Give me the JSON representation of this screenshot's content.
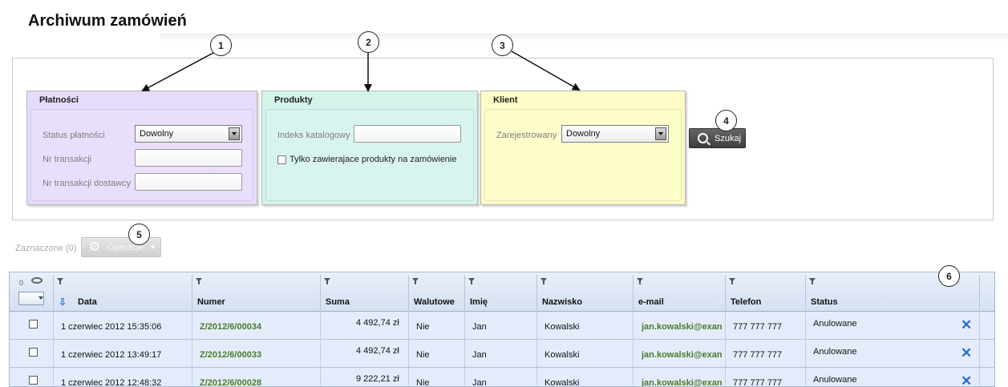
{
  "page_title": "Archiwum zamówień",
  "payments": {
    "title": "Płatności",
    "status_label": "Status płatności",
    "status_value": "Dowolny",
    "trans_label": "Nr transakcji",
    "supplier_trans_label": "Nr transakcji dostawcy"
  },
  "products": {
    "title": "Produkty",
    "index_label": "Indeks katalogowy",
    "checkbox_label": "Tylko zawierajace produkty na zamówienie"
  },
  "client": {
    "title": "Klient",
    "registered_label": "Zarejestrowany",
    "registered_value": "Dowolny"
  },
  "search_label": "Szukaj",
  "selected_label": "Zaznaczone (0)",
  "operations_label": "Operacje",
  "grid": {
    "count": "0",
    "columns": {
      "data": "Data",
      "numer": "Numer",
      "suma": "Suma",
      "walutowe": "Walutowe",
      "imie": "Imię",
      "nazwisko": "Nazwisko",
      "email": "e-mail",
      "telefon": "Telefon",
      "status": "Status"
    },
    "rows": [
      {
        "data": "1 czerwiec 2012 15:35:06",
        "numer": "Z/2012/6/00034",
        "suma": "4 492,74 zł",
        "walutowe": "Nie",
        "imie": "Jan",
        "nazwisko": "Kowalski",
        "email": "jan.kowalski@exan",
        "telefon": "777 777 777",
        "status": "Anulowane"
      },
      {
        "data": "1 czerwiec 2012 13:49:17",
        "numer": "Z/2012/6/00033",
        "suma": "4 492,74 zł",
        "walutowe": "Nie",
        "imie": "Jan",
        "nazwisko": "Kowalski",
        "email": "jan.kowalski@exan",
        "telefon": "777 777 777",
        "status": "Anulowane"
      },
      {
        "data": "1 czerwiec 2012 12:48:32",
        "numer": "Z/2012/6/00028",
        "suma": "9 222,21 zł",
        "walutowe": "Nie",
        "imie": "Jan",
        "nazwisko": "Kowalski",
        "email": "jan.kowalski@exan",
        "telefon": "777 777 777",
        "status": "Anulowane"
      }
    ]
  },
  "callouts": [
    "1",
    "2",
    "3",
    "4",
    "5",
    "6"
  ]
}
